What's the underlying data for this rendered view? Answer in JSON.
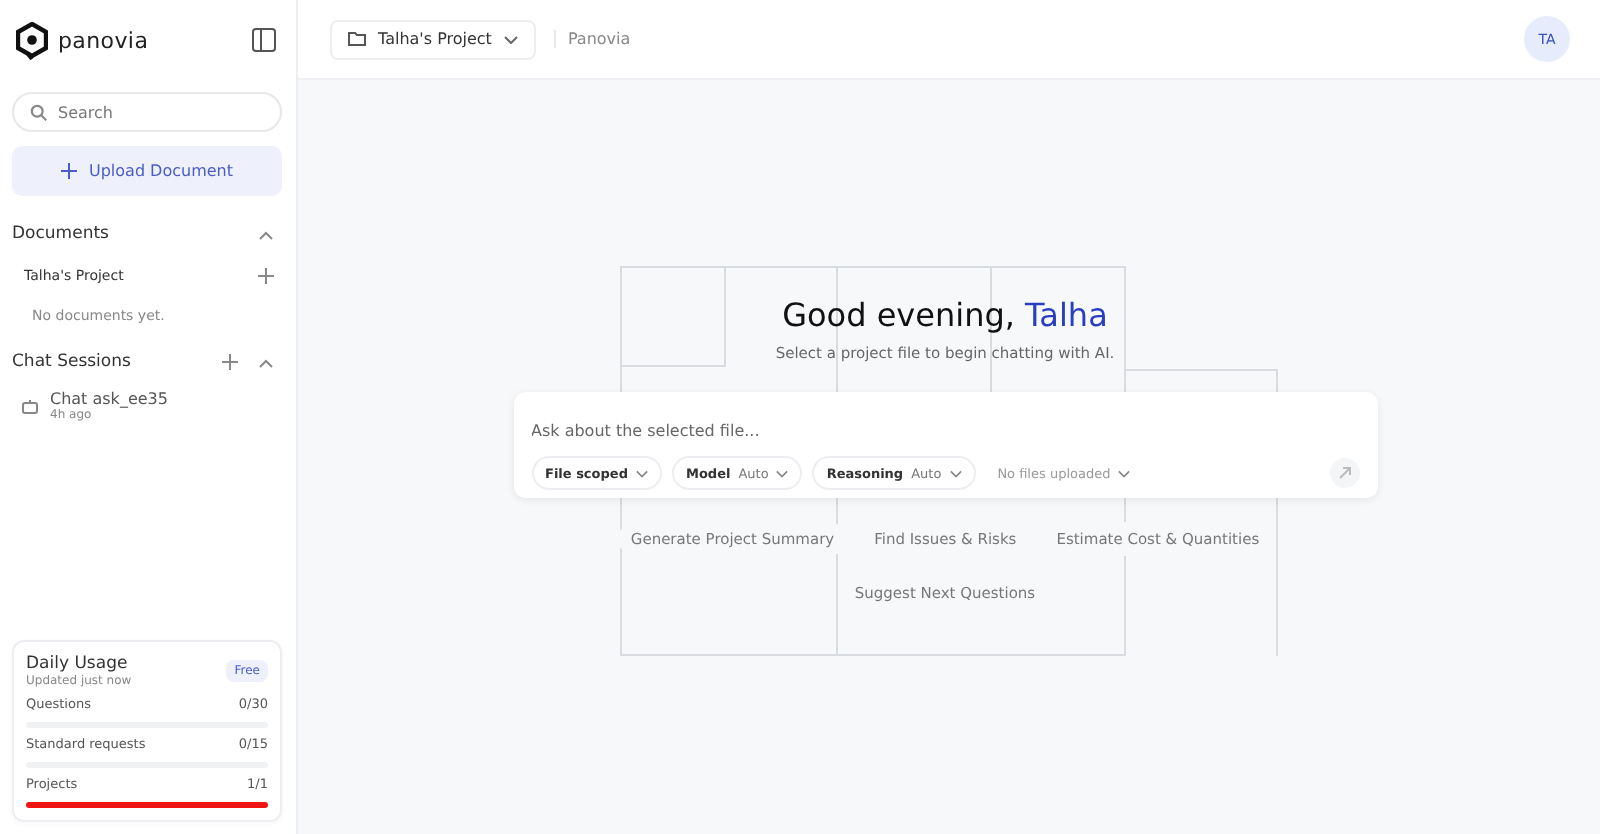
{
  "sidebar": {
    "logo_text": "panovia",
    "search": {
      "placeholder": "Search"
    },
    "upload_button": "Upload Document",
    "documents": {
      "title": "Documents",
      "expanded": true,
      "projects": [
        {
          "name": "Talha's Project",
          "empty_text": "No documents yet."
        }
      ]
    },
    "chat_sessions": {
      "title": "Chat Sessions",
      "expanded": true,
      "items": [
        {
          "title": "Chat ask_ee35",
          "time": "4h ago"
        }
      ]
    },
    "usage": {
      "title": "Daily Usage",
      "subtitle": "Updated just now",
      "plan": "Free",
      "meters": [
        {
          "label": "Questions",
          "value": "0/30"
        },
        {
          "label": "Standard requests",
          "value": "0/15"
        },
        {
          "label": "Projects",
          "value": "1/1",
          "level": 1
        }
      ]
    }
  },
  "header": {
    "project": "Talha's Project",
    "breadcrumb": "Panovia",
    "avatar": "TA"
  },
  "greeting": {
    "text": "Good evening,",
    "name": "Talha",
    "subtitle": "Select a project file to begin chatting with AI."
  },
  "composer": {
    "placeholder": "Ask about the selected file...",
    "controls": [
      {
        "label": "File scoped",
        "kind": "chip"
      },
      {
        "label": "Model",
        "value": "Auto",
        "kind": "chip"
      },
      {
        "label": "Reasoning",
        "value": "Auto",
        "kind": "chip"
      },
      {
        "label": "No files uploaded",
        "kind": "plain"
      }
    ],
    "send_disabled": true
  },
  "suggestions": [
    "Generate Project Summary",
    "Find Issues & Risks",
    "Estimate Cost & Quantities",
    "Suggest Next Questions"
  ]
}
